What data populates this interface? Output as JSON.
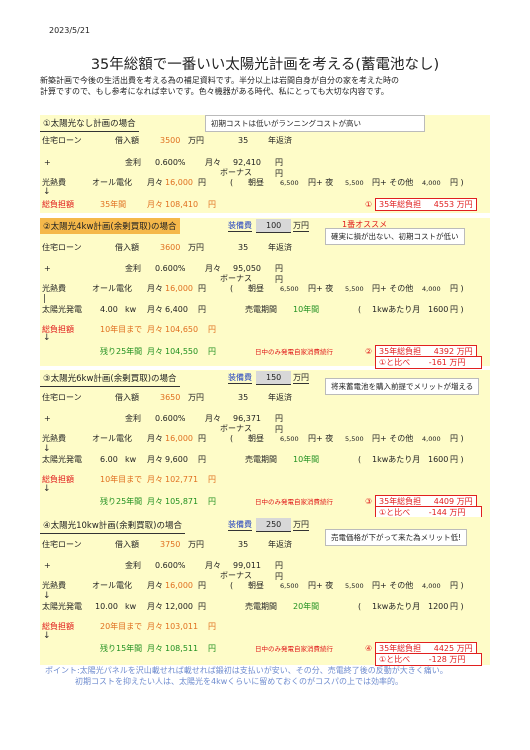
{
  "date": "2023/5/21",
  "title": "35年総額で一番いい太陽光計画を考える(蓄電池なし)",
  "intro": [
    "新築計画で今後の生活出費を考える為の補足資料です。半分以上は岩間自身が自分の家を考えた時の",
    "計算ですので、もし参考になれば幸いです。色々機器がある時代、私にとっても大切な内容です。"
  ],
  "labels": {
    "loan": "住宅ローン",
    "borrow": "借入額",
    "man_yen": "万円",
    "years": "年返済",
    "plus": "+",
    "interest": "金利",
    "monthly": "月々",
    "yen": "円",
    "bonus": "ボーナス",
    "utility": "光熱費",
    "all_electric": "オール電化",
    "paren_open": "(",
    "morning_day": "朝昼",
    "night": "円+ 夜",
    "other": "円+ その他",
    "paren_close": "円 )",
    "burden": "総負担額",
    "solar_gen": "太陽光発電",
    "kw": "kw",
    "sell_period": "売電期間",
    "per_kw": "1kwあたり月",
    "equipment": "装備費",
    "daytime_note": "日中のみ発電自家消費続行",
    "total_burden": "35年総負担",
    "vs_one": "①と比べ",
    "down_arrow": "↓",
    "bar": "|"
  },
  "s1": {
    "header": "①太陽光なし計画の場合",
    "callout": "初期コストは低いがランニングコストが高い",
    "borrow": "3500",
    "years": "35",
    "rate": "0.600%",
    "loan_monthly": "92,410",
    "util_monthly": "16,000",
    "day": "6,500",
    "night": "5,500",
    "other": "4,000",
    "burden_period": "35年間",
    "burden_monthly": "108,410",
    "total_no": "①",
    "total": "4553 万円"
  },
  "s2": {
    "header": "②太陽光4kw計画(余剰買取)の場合",
    "equip": "100",
    "rank": "1番オススメ",
    "callout": "確実に損が出ない、初期コストが低い",
    "borrow": "3600",
    "years": "35",
    "rate": "0.600%",
    "loan_monthly": "95,050",
    "util_monthly": "16,000",
    "day": "6,500",
    "night": "5,500",
    "other": "4,000",
    "kw": "4.00",
    "gen_monthly": "6,400",
    "sell_years": "10年間",
    "per_kw": "1600",
    "burden1_period": "10年目まで",
    "burden1_monthly": "104,650",
    "burden2_period": "残り25年間",
    "burden2_monthly": "104,550",
    "total_no": "②",
    "total": "4392 万円",
    "diff": "-161 万円"
  },
  "s3": {
    "header": "③太陽光6kw計画(余剰買取)の場合",
    "equip": "150",
    "callout": "将来蓄電池を購入前提でメリットが増える",
    "borrow": "3650",
    "years": "35",
    "rate": "0.600%",
    "loan_monthly": "96,371",
    "util_monthly": "16,000",
    "day": "6,500",
    "night": "5,500",
    "other": "4,000",
    "kw": "6.00",
    "gen_monthly": "9,600",
    "sell_years": "10年間",
    "per_kw": "1600",
    "burden1_period": "10年目まで",
    "burden1_monthly": "102,771",
    "burden2_period": "残り25年間",
    "burden2_monthly": "105,871",
    "total_no": "③",
    "total": "4409 万円",
    "diff": "-144 万円"
  },
  "s4": {
    "header": "④太陽光10kw計画(余剰買取)の場合",
    "equip": "250",
    "callout": "売電価格が下がって来た為メリット低!",
    "borrow": "3750",
    "years": "35",
    "rate": "0.600%",
    "loan_monthly": "99,011",
    "util_monthly": "16,000",
    "day": "6,500",
    "night": "5,500",
    "other": "4,000",
    "kw": "10.00",
    "gen_monthly": "12,000",
    "sell_years": "20年間",
    "per_kw": "1200",
    "burden1_period": "20年目まで",
    "burden1_monthly": "103,011",
    "burden2_period": "残り15年間",
    "burden2_monthly": "108,511",
    "total_no": "④",
    "total": "4425 万円",
    "diff": "-128 万円"
  },
  "footer": [
    "ポイント:太陽光パネルを沢山載せれば載せれば鍛初は支払いが安い、その分、売電終了後の反動が大きく痛い。",
    "初期コストを抑えたい人は、太陽光を4kwくらいに留めておくのがコスパの上では効率的。"
  ]
}
